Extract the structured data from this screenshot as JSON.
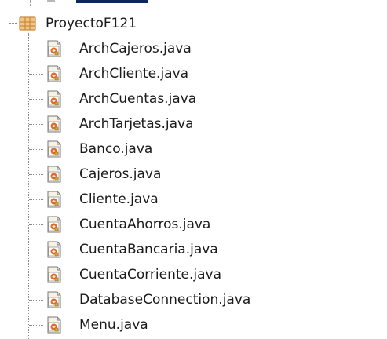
{
  "project": {
    "name": "ProyectoF121",
    "icon": "java-project-icon"
  },
  "files": [
    {
      "label": "ArchCajeros.java",
      "icon": "java-source-file-icon"
    },
    {
      "label": "ArchCliente.java",
      "icon": "java-source-file-icon"
    },
    {
      "label": "ArchCuentas.java",
      "icon": "java-source-file-icon"
    },
    {
      "label": "ArchTarjetas.java",
      "icon": "java-source-file-icon"
    },
    {
      "label": "Banco.java",
      "icon": "java-source-file-icon"
    },
    {
      "label": "Cajeros.java",
      "icon": "java-source-file-icon"
    },
    {
      "label": "Cliente.java",
      "icon": "java-source-file-icon"
    },
    {
      "label": "CuentaAhorros.java",
      "icon": "java-source-file-icon"
    },
    {
      "label": "CuentaBancaria.java",
      "icon": "java-source-file-icon"
    },
    {
      "label": "CuentaCorriente.java",
      "icon": "java-source-file-icon"
    },
    {
      "label": "DatabaseConnection.java",
      "icon": "java-source-file-icon"
    },
    {
      "label": "Menu.java",
      "icon": "java-source-file-icon"
    }
  ],
  "colors": {
    "project_icon_fill": "#f2c48a",
    "project_icon_stroke": "#c88a3a",
    "file_icon_page": "#f7f2e6",
    "file_icon_badge": "#e06c2c",
    "tree_line": "#8a8a8a"
  }
}
